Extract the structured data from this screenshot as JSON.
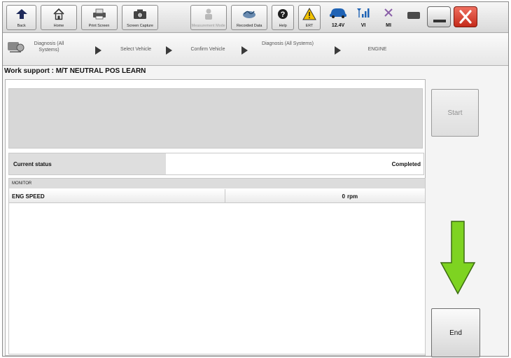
{
  "toolbar": {
    "buttons": [
      {
        "label": "Back",
        "icon": "back-arrow-icon",
        "enabled": true
      },
      {
        "label": "Home",
        "icon": "home-icon",
        "enabled": true
      },
      {
        "label": "Print Screen",
        "icon": "printer-icon",
        "enabled": true
      },
      {
        "label": "Screen Capture",
        "icon": "camera-icon",
        "enabled": true
      },
      {
        "label": "Measurement Mode",
        "icon": "measurement-icon",
        "enabled": false
      },
      {
        "label": "Recorded Data",
        "icon": "recorded-data-icon",
        "enabled": true
      },
      {
        "label": "Help",
        "icon": "help-icon",
        "enabled": true
      },
      {
        "label": "ERT",
        "icon": "warning-icon",
        "enabled": true
      }
    ],
    "status": {
      "voltage": "12.4V",
      "vi": "VI",
      "mi": "MI"
    }
  },
  "breadcrumbs": [
    "Diagnosis (All Systems)",
    "Select Vehicle",
    "Confirm Vehicle",
    "Diagnosis (All Systems)",
    "ENGINE"
  ],
  "page_title": "Work support : M/T NEUTRAL POS LEARN",
  "message_box": "",
  "current_status": {
    "label": "Current status",
    "value": "Completed"
  },
  "monitor": {
    "header": "MONITOR",
    "rows": [
      {
        "name": "ENG SPEED",
        "value": "0",
        "unit": "rpm"
      }
    ]
  },
  "buttons": {
    "start": "Start",
    "end": "End"
  },
  "colors": {
    "arrow_fill": "#7ed321",
    "arrow_outline": "#3c6b12",
    "close_red": "#e03b2a"
  }
}
